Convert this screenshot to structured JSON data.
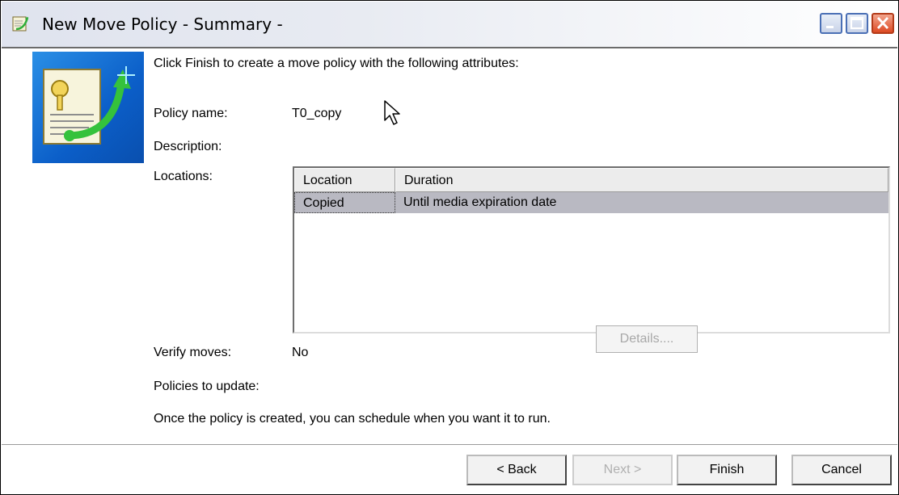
{
  "window": {
    "title": "New Move Policy - Summary -"
  },
  "summary": {
    "intro": "Click Finish to create a move policy with the following attributes:",
    "policy_name_label": "Policy name:",
    "policy_name_value": "T0_copy",
    "description_label": "Description:",
    "locations_label": "Locations:",
    "verify_moves_label": "Verify moves:",
    "verify_moves_value": "No",
    "policies_to_update_label": "Policies to update:",
    "details_button": "Details....",
    "footer_note": "Once the policy is created, you can schedule when you want it to run."
  },
  "locations_table": {
    "columns": [
      "Location",
      "Duration"
    ],
    "rows": [
      {
        "location": "Copied",
        "duration": "Until media expiration date"
      }
    ]
  },
  "buttons": {
    "back": "< Back",
    "next": "Next >",
    "finish": "Finish",
    "cancel": "Cancel"
  },
  "icons": {
    "app": "move-policy-icon",
    "wizard": "document-arrow-icon",
    "minimize": "minimize-icon",
    "maximize": "maximize-icon",
    "close": "close-icon",
    "cursor": "mouse-pointer-icon"
  }
}
